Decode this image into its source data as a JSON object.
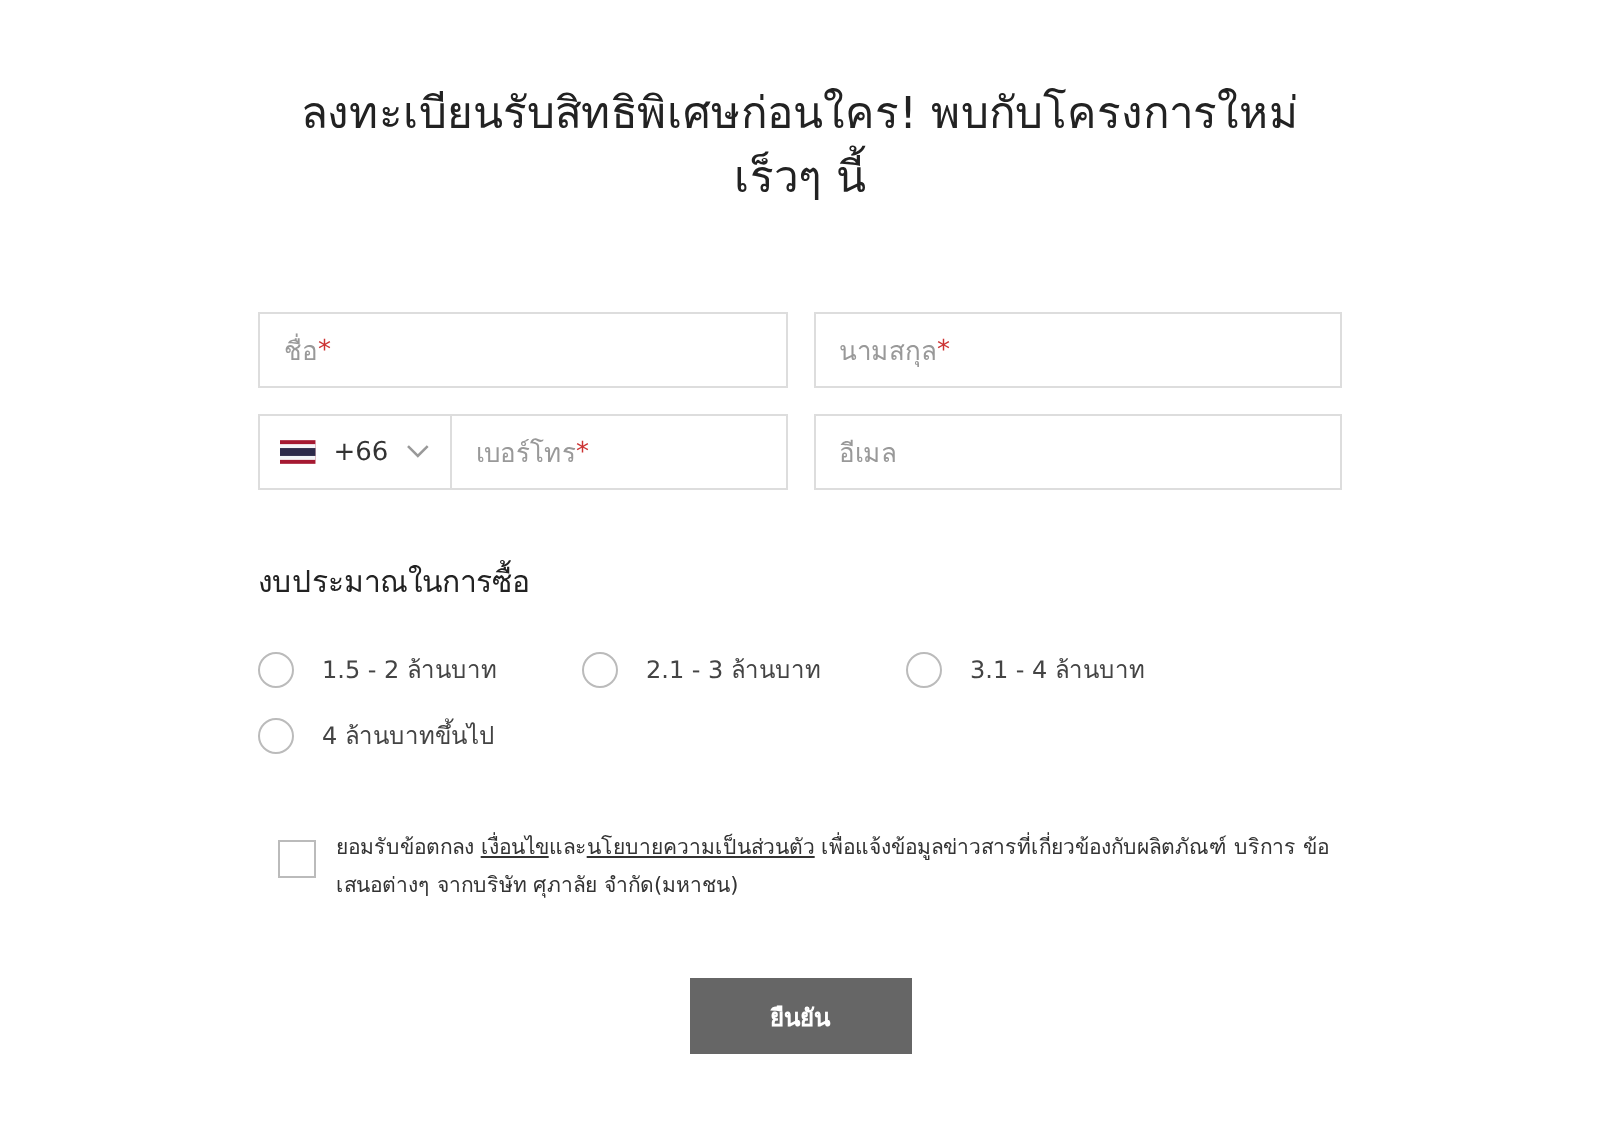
{
  "title": "ลงทะเบียนรับสิทธิพิเศษก่อนใคร! พบกับโครงการใหม่ เร็วๆ นี้",
  "fields": [
    {
      "kind": "text",
      "placeholder": "ชื่อ",
      "required_mark": "*"
    },
    {
      "kind": "text",
      "placeholder": "นามสกุล",
      "required_mark": "*"
    },
    {
      "kind": "phone",
      "country_code": "+66",
      "placeholder": "เบอร์โทร",
      "required_mark": "*"
    },
    {
      "kind": "text",
      "placeholder": "อีเมล"
    }
  ],
  "budget": {
    "label": "งบประมาณในการซื้อ",
    "options": [
      {
        "label": "1.5 - 2 ล้านบาท",
        "selected": false
      },
      {
        "label": "2.1 - 3 ล้านบาท",
        "selected": false
      },
      {
        "label": "3.1 - 4 ล้านบาท",
        "selected": false
      },
      {
        "label": "4 ล้านบาทขึ้นไป",
        "selected": false
      }
    ]
  },
  "consent": {
    "checked": false,
    "parts": [
      {
        "kind": "text",
        "text": "ยอมรับข้อตกลง "
      },
      {
        "kind": "link",
        "text": "เงื่อนไข"
      },
      {
        "kind": "text",
        "text": "และ"
      },
      {
        "kind": "link",
        "text": "นโยบายความเป็นส่วนตัว"
      },
      {
        "kind": "text",
        "text": " เพื่อแจ้งข้อมูลข่าวสารที่เกี่ยวข้องกับผลิตภัณฑ์ บริการ ข้อเสนอต่างๆ จากบริษัท ศุภาลัย จำกัด(มหาชน)"
      }
    ]
  },
  "submit": "ยืนยัน"
}
